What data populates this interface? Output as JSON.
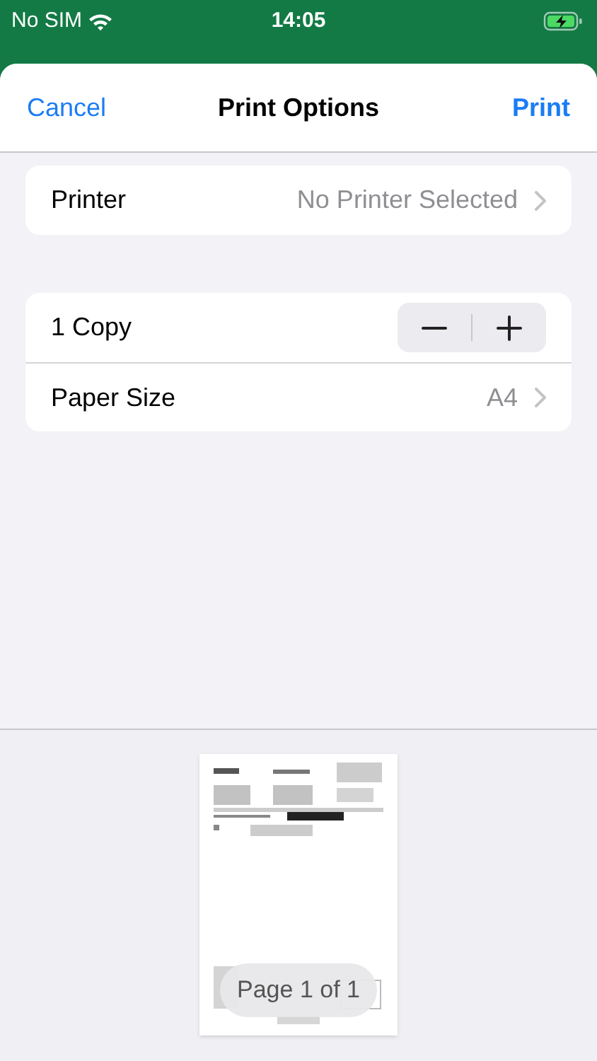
{
  "status_bar": {
    "carrier": "No SIM",
    "time": "14:05"
  },
  "sheet": {
    "cancel": "Cancel",
    "title": "Print Options",
    "print": "Print"
  },
  "printer_group": [
    {
      "kind": "link",
      "label": "Printer",
      "value": "No Printer Selected"
    }
  ],
  "options_group": [
    {
      "kind": "stepper",
      "label": "1 Copy"
    },
    {
      "kind": "link",
      "label": "Paper Size",
      "value": "A4"
    }
  ],
  "preview": {
    "page_label": "Page 1 of 1"
  }
}
